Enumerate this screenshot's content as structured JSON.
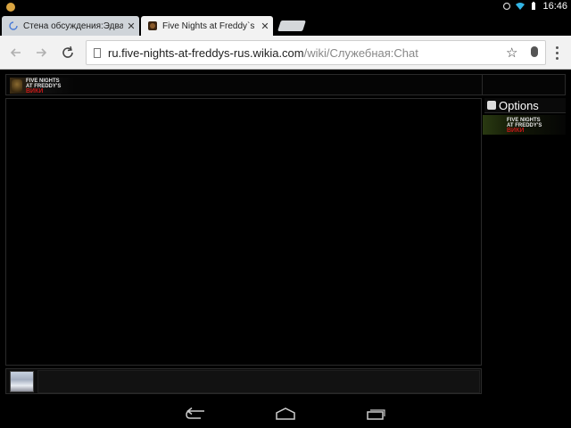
{
  "status_bar": {
    "time": "16:46",
    "icons": [
      "notification-icon",
      "sync-icon",
      "wifi-icon",
      "battery-icon"
    ]
  },
  "tabs": [
    {
      "label": "Стена обсуждения:Эдвард",
      "active": false,
      "icon": "loading-icon"
    },
    {
      "label": "Five Nights at Freddy`s вики",
      "active": true,
      "icon": "fnaf-favicon-icon"
    }
  ],
  "toolbar": {
    "url_host": "ru.five-nights-at-freddys-rus.wikia.com",
    "url_path": "/wiki/Служебная:Chat"
  },
  "chat": {
    "logo_lines": [
      "FIVE NIGHTS",
      "AT FREDDY'S"
    ],
    "logo_wiki": "ВИКИ",
    "options_label": "Options",
    "message_input": ""
  },
  "colors": {
    "page_background": "#000000",
    "border": "#2a2a2a",
    "wiki_red": "#c31818"
  }
}
